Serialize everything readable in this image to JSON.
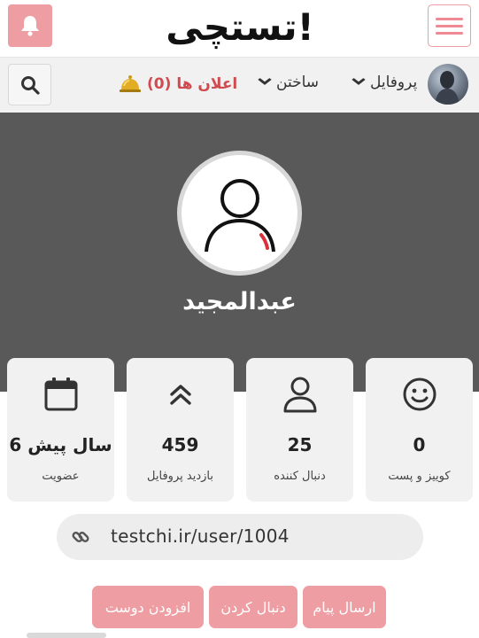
{
  "header": {
    "logo_text": "تستچی!",
    "accent_color": "#ee9da3"
  },
  "nav": {
    "profile_label": "پروفایل",
    "build_label": "ساختن",
    "notifications_label": "اعلان ها (0)"
  },
  "profile": {
    "username": "عبدالمجید"
  },
  "stats": {
    "quiz_post": {
      "value": "0",
      "label": "کوییز و پست"
    },
    "followers": {
      "value": "25",
      "label": "دنبال کننده"
    },
    "profile_views": {
      "value": "459",
      "label": "بازدید پروفایل"
    },
    "membership": {
      "value": "6 سال پیش",
      "label": "عضویت"
    }
  },
  "profile_link": {
    "url": "testchi.ir/user/1004"
  },
  "actions": {
    "send_message": "ارسال پیام",
    "follow": "دنبال کردن",
    "add_friend": "افزودن دوست"
  }
}
